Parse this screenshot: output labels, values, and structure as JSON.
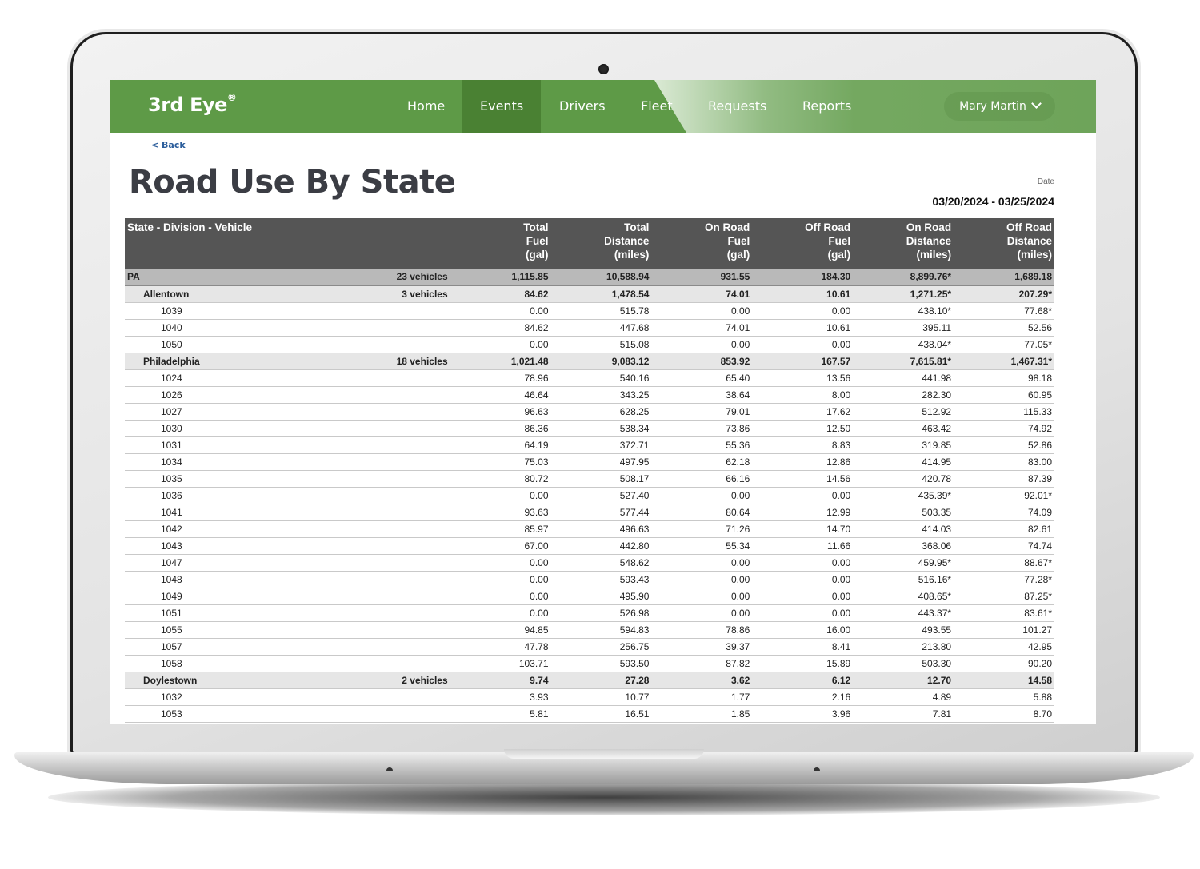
{
  "nav": {
    "brand": "3rd Eye",
    "brand_mark": "®",
    "items": [
      {
        "label": "Home",
        "active": false
      },
      {
        "label": "Events",
        "active": true
      },
      {
        "label": "Drivers",
        "active": false
      },
      {
        "label": "Fleet",
        "active": false
      },
      {
        "label": "Requests",
        "active": false
      },
      {
        "label": "Reports",
        "active": false
      }
    ],
    "user": "Mary Martin"
  },
  "back_link": "< Back",
  "page_title": "Road Use By State",
  "date": {
    "label": "Date",
    "value": "03/20/2024 - 03/25/2024"
  },
  "table": {
    "headers": [
      "State - Division - Vehicle",
      "",
      "Total\nFuel\n(gal)",
      "Total\nDistance\n(miles)",
      "On Road\nFuel\n(gal)",
      "Off Road\nFuel\n(gal)",
      "On Road\nDistance\n(miles)",
      "Off Road\nDistance\n(miles)"
    ],
    "rows": [
      {
        "type": "state",
        "name": "PA",
        "count": "23 vehicles",
        "values": [
          "1,115.85",
          "10,588.94",
          "931.55",
          "184.30",
          "8,899.76*",
          "1,689.18"
        ]
      },
      {
        "type": "division",
        "name": "Allentown",
        "count": "3 vehicles",
        "values": [
          "84.62",
          "1,478.54",
          "74.01",
          "10.61",
          "1,271.25*",
          "207.29*"
        ]
      },
      {
        "type": "vehicle",
        "name": "1039",
        "count": "",
        "values": [
          "0.00",
          "515.78",
          "0.00",
          "0.00",
          "438.10*",
          "77.68*"
        ]
      },
      {
        "type": "vehicle",
        "name": "1040",
        "count": "",
        "values": [
          "84.62",
          "447.68",
          "74.01",
          "10.61",
          "395.11",
          "52.56"
        ]
      },
      {
        "type": "vehicle",
        "name": "1050",
        "count": "",
        "values": [
          "0.00",
          "515.08",
          "0.00",
          "0.00",
          "438.04*",
          "77.05*"
        ]
      },
      {
        "type": "division",
        "name": "Philadelphia",
        "count": "18 vehicles",
        "values": [
          "1,021.48",
          "9,083.12",
          "853.92",
          "167.57",
          "7,615.81*",
          "1,467.31*"
        ]
      },
      {
        "type": "vehicle",
        "name": "1024",
        "count": "",
        "values": [
          "78.96",
          "540.16",
          "65.40",
          "13.56",
          "441.98",
          "98.18"
        ]
      },
      {
        "type": "vehicle",
        "name": "1026",
        "count": "",
        "values": [
          "46.64",
          "343.25",
          "38.64",
          "8.00",
          "282.30",
          "60.95"
        ]
      },
      {
        "type": "vehicle",
        "name": "1027",
        "count": "",
        "values": [
          "96.63",
          "628.25",
          "79.01",
          "17.62",
          "512.92",
          "115.33"
        ]
      },
      {
        "type": "vehicle",
        "name": "1030",
        "count": "",
        "values": [
          "86.36",
          "538.34",
          "73.86",
          "12.50",
          "463.42",
          "74.92"
        ]
      },
      {
        "type": "vehicle",
        "name": "1031",
        "count": "",
        "values": [
          "64.19",
          "372.71",
          "55.36",
          "8.83",
          "319.85",
          "52.86"
        ]
      },
      {
        "type": "vehicle",
        "name": "1034",
        "count": "",
        "values": [
          "75.03",
          "497.95",
          "62.18",
          "12.86",
          "414.95",
          "83.00"
        ]
      },
      {
        "type": "vehicle",
        "name": "1035",
        "count": "",
        "values": [
          "80.72",
          "508.17",
          "66.16",
          "14.56",
          "420.78",
          "87.39"
        ]
      },
      {
        "type": "vehicle",
        "name": "1036",
        "count": "",
        "values": [
          "0.00",
          "527.40",
          "0.00",
          "0.00",
          "435.39*",
          "92.01*"
        ]
      },
      {
        "type": "vehicle",
        "name": "1041",
        "count": "",
        "values": [
          "93.63",
          "577.44",
          "80.64",
          "12.99",
          "503.35",
          "74.09"
        ]
      },
      {
        "type": "vehicle",
        "name": "1042",
        "count": "",
        "values": [
          "85.97",
          "496.63",
          "71.26",
          "14.70",
          "414.03",
          "82.61"
        ]
      },
      {
        "type": "vehicle",
        "name": "1043",
        "count": "",
        "values": [
          "67.00",
          "442.80",
          "55.34",
          "11.66",
          "368.06",
          "74.74"
        ]
      },
      {
        "type": "vehicle",
        "name": "1047",
        "count": "",
        "values": [
          "0.00",
          "548.62",
          "0.00",
          "0.00",
          "459.95*",
          "88.67*"
        ]
      },
      {
        "type": "vehicle",
        "name": "1048",
        "count": "",
        "values": [
          "0.00",
          "593.43",
          "0.00",
          "0.00",
          "516.16*",
          "77.28*"
        ]
      },
      {
        "type": "vehicle",
        "name": "1049",
        "count": "",
        "values": [
          "0.00",
          "495.90",
          "0.00",
          "0.00",
          "408.65*",
          "87.25*"
        ]
      },
      {
        "type": "vehicle",
        "name": "1051",
        "count": "",
        "values": [
          "0.00",
          "526.98",
          "0.00",
          "0.00",
          "443.37*",
          "83.61*"
        ]
      },
      {
        "type": "vehicle",
        "name": "1055",
        "count": "",
        "values": [
          "94.85",
          "594.83",
          "78.86",
          "16.00",
          "493.55",
          "101.27"
        ]
      },
      {
        "type": "vehicle",
        "name": "1057",
        "count": "",
        "values": [
          "47.78",
          "256.75",
          "39.37",
          "8.41",
          "213.80",
          "42.95"
        ]
      },
      {
        "type": "vehicle",
        "name": "1058",
        "count": "",
        "values": [
          "103.71",
          "593.50",
          "87.82",
          "15.89",
          "503.30",
          "90.20"
        ]
      },
      {
        "type": "division",
        "name": "Doylestown",
        "count": "2 vehicles",
        "values": [
          "9.74",
          "27.28",
          "3.62",
          "6.12",
          "12.70",
          "14.58"
        ]
      },
      {
        "type": "vehicle",
        "name": "1032",
        "count": "",
        "values": [
          "3.93",
          "10.77",
          "1.77",
          "2.16",
          "4.89",
          "5.88"
        ]
      },
      {
        "type": "vehicle",
        "name": "1053",
        "count": "",
        "values": [
          "5.81",
          "16.51",
          "1.85",
          "3.96",
          "7.81",
          "8.70"
        ]
      }
    ]
  }
}
